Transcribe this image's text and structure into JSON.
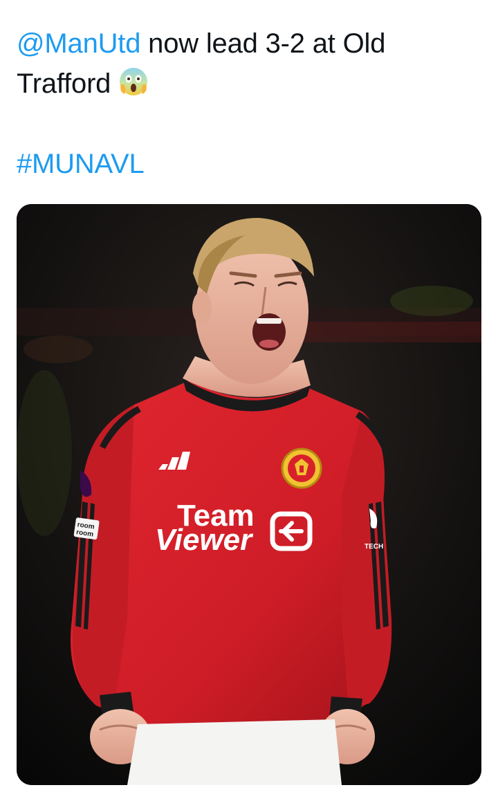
{
  "tweet": {
    "mention": "@ManUtd",
    "text_line1": " now lead 3-2 at Old",
    "text_line2": "Trafford",
    "emoji_icon": "face-screaming-in-fear",
    "hashtag": "#MUNAVL"
  },
  "media": {
    "description_icon": "celebrating-player-photo",
    "jersey": {
      "sponsor_line1": "Team",
      "sponsor_line2": "Viewer",
      "badge_icon": "manchester-united-crest",
      "brand_icon": "adidas-logo",
      "sleeve_patch_text": "room\nroom",
      "right_sleeve_text": "TECH"
    },
    "colors": {
      "jersey_red": "#d8202a",
      "jersey_dark_red": "#8e1116",
      "accent_black": "#1a1a1a",
      "link_blue": "#1d9bf0"
    }
  }
}
